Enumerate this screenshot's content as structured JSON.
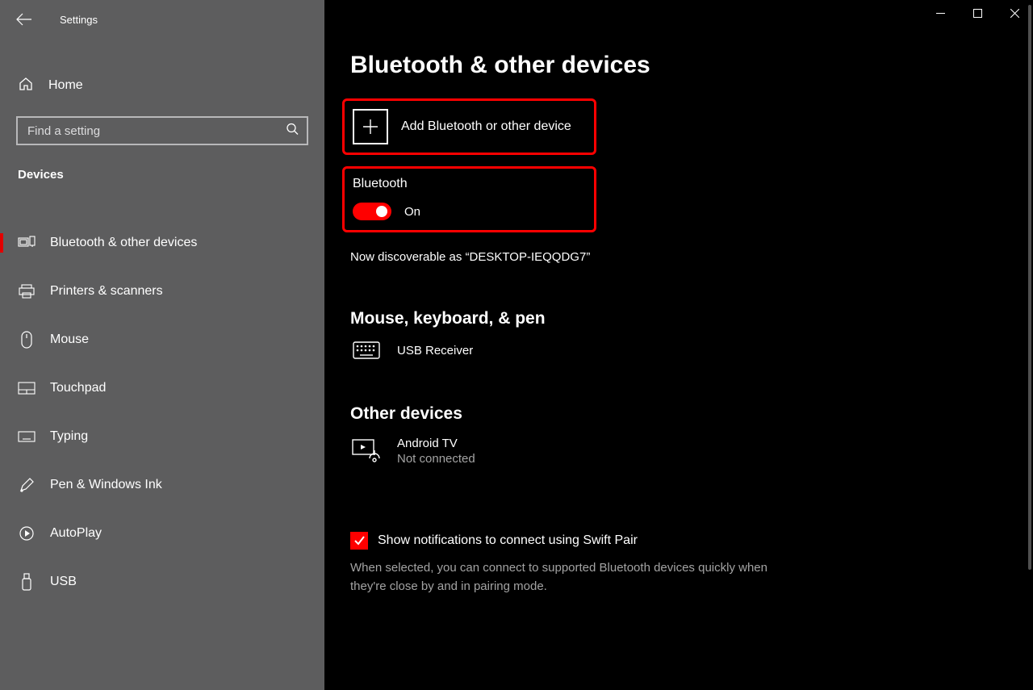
{
  "window": {
    "title": "Settings"
  },
  "sidebar": {
    "home_label": "Home",
    "search_placeholder": "Find a setting",
    "section_label": "Devices",
    "items": [
      {
        "label": "Bluetooth & other devices",
        "active": true
      },
      {
        "label": "Printers & scanners"
      },
      {
        "label": "Mouse"
      },
      {
        "label": "Touchpad"
      },
      {
        "label": "Typing"
      },
      {
        "label": "Pen & Windows Ink"
      },
      {
        "label": "AutoPlay"
      },
      {
        "label": "USB"
      }
    ]
  },
  "main": {
    "title": "Bluetooth & other devices",
    "add_device_label": "Add Bluetooth or other device",
    "bluetooth_heading": "Bluetooth",
    "toggle_state": "On",
    "discoverable_text": "Now discoverable as “DESKTOP-IEQQDG7”",
    "sections": {
      "mouse_kb": {
        "heading": "Mouse, keyboard, & pen",
        "device_name": "USB Receiver"
      },
      "other": {
        "heading": "Other devices",
        "device_name": "Android TV",
        "device_status": "Not connected"
      }
    },
    "swift_pair": {
      "label": "Show notifications to connect using Swift Pair",
      "description": "When selected, you can connect to supported Bluetooth devices quickly when they're close by and in pairing mode."
    }
  }
}
